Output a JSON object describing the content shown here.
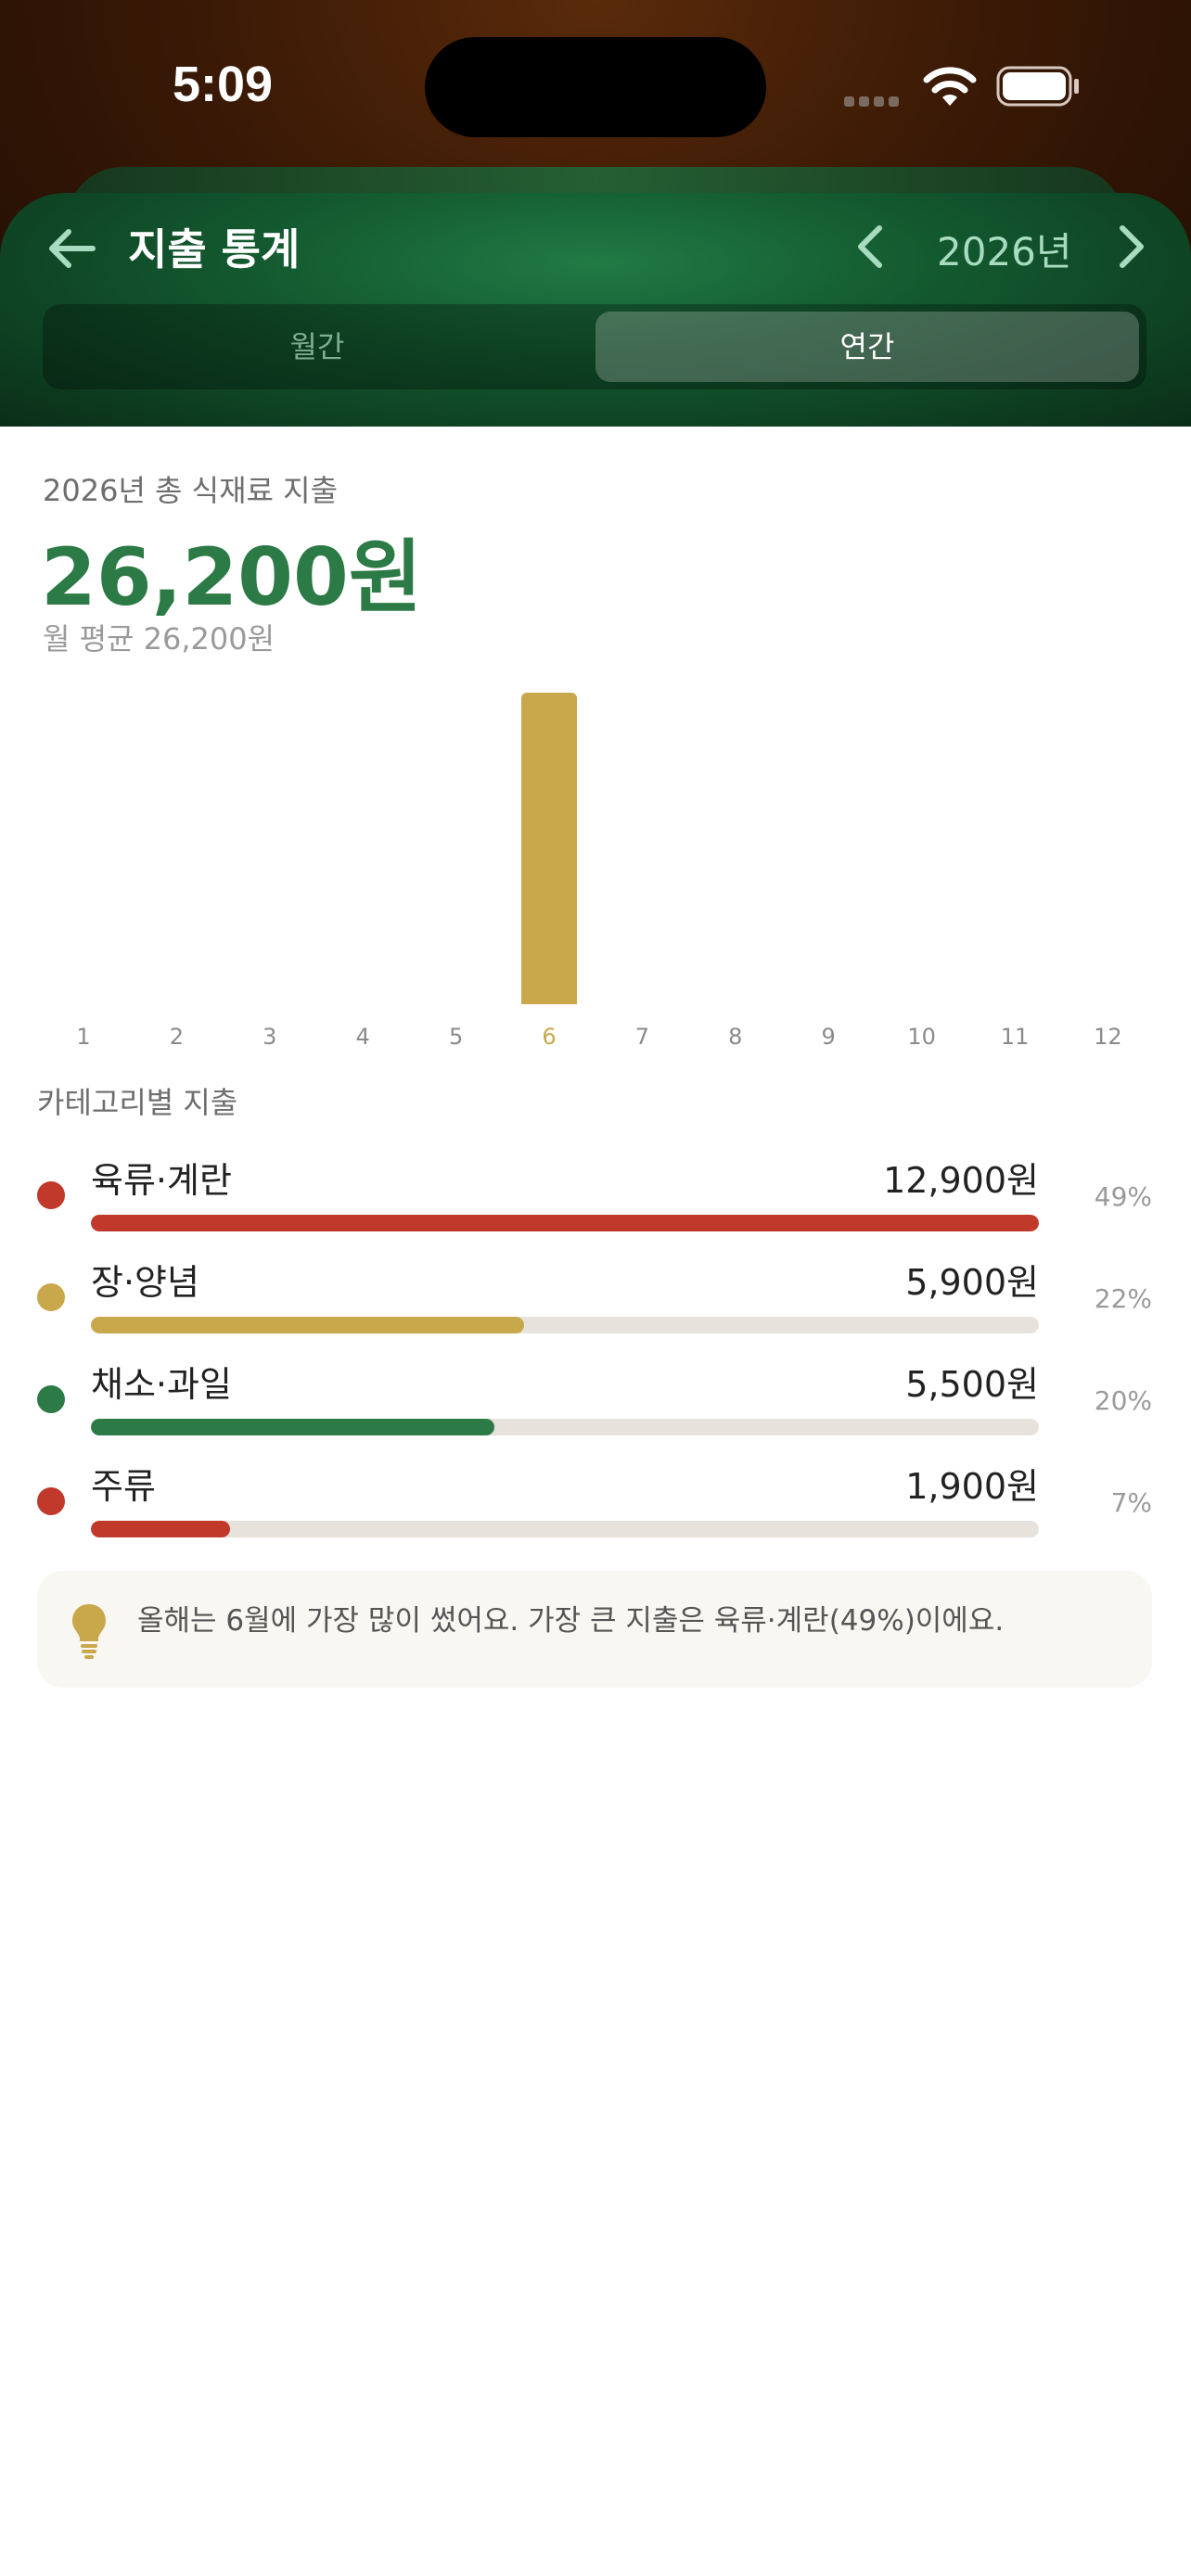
{
  "status_bar": {
    "time": "5:09"
  },
  "header": {
    "title": "지출 통계",
    "year": "2026년"
  },
  "segment": {
    "monthly": "월간",
    "yearly": "연간",
    "selected": "연간"
  },
  "summary": {
    "label": "2026년 총 식재료 지출",
    "total": "26,200원",
    "average": "월 평균 26,200원"
  },
  "chart_data": {
    "type": "bar",
    "categories": [
      "1",
      "2",
      "3",
      "4",
      "5",
      "6",
      "7",
      "8",
      "9",
      "10",
      "11",
      "12"
    ],
    "values": [
      0,
      0,
      0,
      0,
      0,
      26200,
      0,
      0,
      0,
      0,
      0,
      0
    ],
    "highlight_index": 5,
    "bar_color": "#c9a84c",
    "highlight_label_color": "#c9a84c",
    "label_color": "#8a8a8a",
    "title": "",
    "xlabel": "",
    "ylabel": "",
    "ylim": [
      0,
      26200
    ],
    "grid": false
  },
  "categories": {
    "heading": "카테고리별 지출",
    "items": [
      {
        "name": "육류·계란",
        "amount": "12,900원",
        "percent": "49%",
        "ratio": 1.0,
        "color": "#c0392b"
      },
      {
        "name": "장·양념",
        "amount": "5,900원",
        "percent": "22%",
        "ratio": 0.457,
        "color": "#c9a84c"
      },
      {
        "name": "채소·과일",
        "amount": "5,500원",
        "percent": "20%",
        "ratio": 0.426,
        "color": "#2c7a45"
      },
      {
        "name": "주류",
        "amount": "1,900원",
        "percent": "7%",
        "ratio": 0.147,
        "color": "#c0392b"
      }
    ]
  },
  "tip": {
    "icon": "lightbulb-icon",
    "text": "올해는 6월에 가장 많이 썼어요. 가장 큰 지출은 육류·계란(49%)이에요."
  },
  "colors": {
    "accent_green": "#2c7a45",
    "header_green": "#1a6a3a",
    "gold": "#c9a84c"
  }
}
